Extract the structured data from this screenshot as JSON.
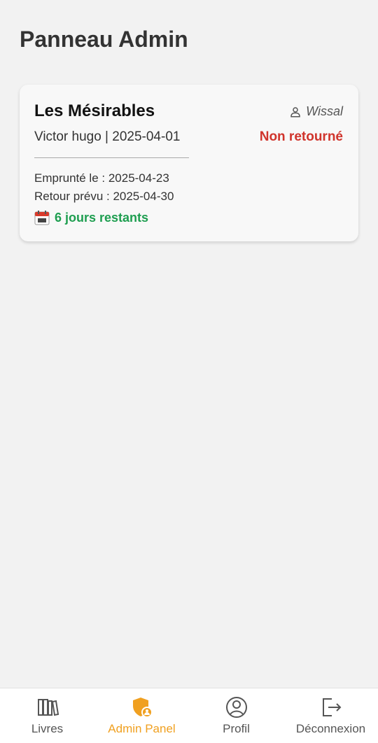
{
  "header": {
    "title": "Panneau Admin"
  },
  "loan": {
    "book_title": "Les Mésirables",
    "user_icon": "user-icon",
    "user_name": "Wissal",
    "author_line": "Victor hugo | 2025-04-01",
    "status": "Non retourné",
    "borrowed_label": "Emprunté le : 2025-04-23",
    "due_label": "Retour prévu : 2025-04-30",
    "remaining_icon": "calendar-icon",
    "remaining_text": "6 jours restants",
    "colors": {
      "status": "#d0342c",
      "remaining": "#1e9e50"
    }
  },
  "nav": {
    "active_color": "#f0a020",
    "items": [
      {
        "label": "Livres",
        "icon": "books-icon"
      },
      {
        "label": "Admin Panel",
        "icon": "admin-shield-icon"
      },
      {
        "label": "Profil",
        "icon": "profile-icon"
      },
      {
        "label": "Déconnexion",
        "icon": "logout-icon"
      }
    ]
  }
}
